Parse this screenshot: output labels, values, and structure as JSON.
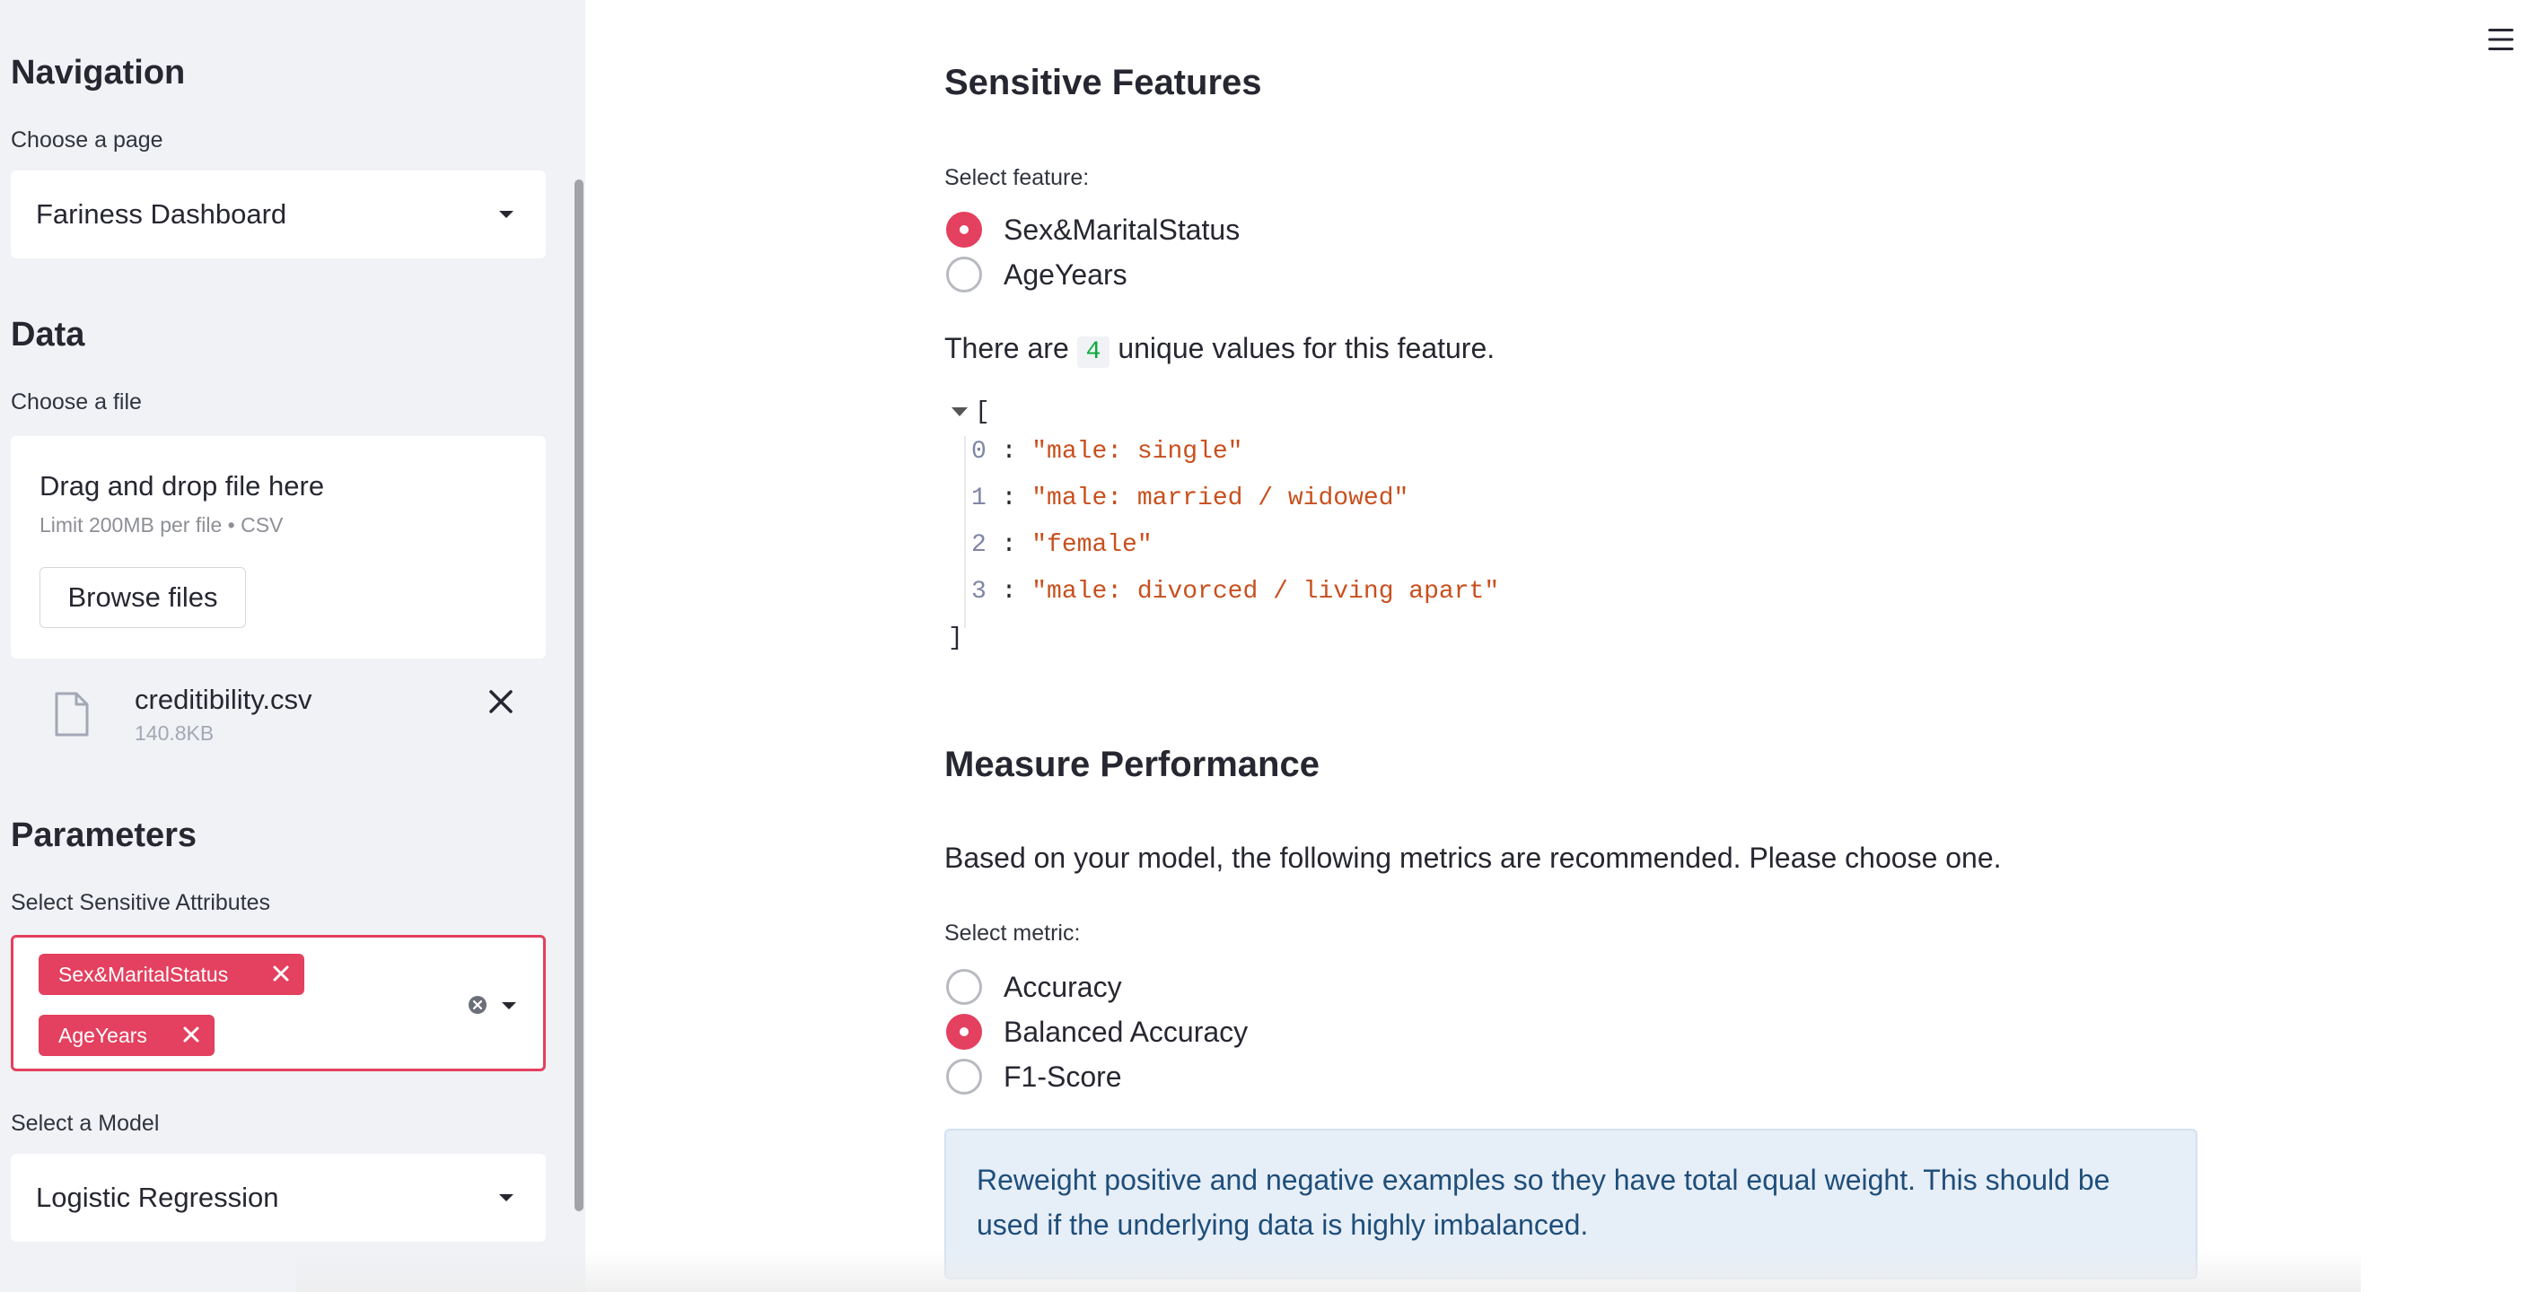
{
  "sidebar": {
    "navigation": {
      "heading": "Navigation",
      "label": "Choose a page",
      "selected": "Fariness Dashboard"
    },
    "data": {
      "heading": "Data",
      "label": "Choose a file",
      "dropzone_title": "Drag and drop file here",
      "dropzone_limit": "Limit 200MB per file • CSV",
      "browse_label": "Browse files",
      "file": {
        "name": "creditibility.csv",
        "size": "140.8KB"
      }
    },
    "parameters": {
      "heading": "Parameters",
      "sensitive_label": "Select Sensitive Attributes",
      "sensitive_selected": [
        "Sex&MaritalStatus",
        "AgeYears"
      ],
      "model_label": "Select a Model",
      "model_selected": "Logistic Regression"
    }
  },
  "main": {
    "sensitive": {
      "heading": "Sensitive Features",
      "select_label": "Select feature:",
      "options": [
        {
          "label": "Sex&MaritalStatus",
          "selected": true
        },
        {
          "label": "AgeYears",
          "selected": false
        }
      ],
      "unique_prefix": "There are",
      "unique_count": "4",
      "unique_suffix": "unique values for this feature.",
      "json_open": "[",
      "json_close": "]",
      "values": [
        {
          "index": "0",
          "value": "\"male: single\""
        },
        {
          "index": "1",
          "value": "\"male: married / widowed\""
        },
        {
          "index": "2",
          "value": "\"female\""
        },
        {
          "index": "3",
          "value": "\"male: divorced / living apart\""
        }
      ]
    },
    "performance": {
      "heading": "Measure Performance",
      "intro": "Based on your model, the following metrics are recommended. Please choose one.",
      "select_label": "Select metric:",
      "options": [
        {
          "label": "Accuracy",
          "selected": false
        },
        {
          "label": "Balanced Accuracy",
          "selected": true
        },
        {
          "label": "F1-Score",
          "selected": false
        }
      ],
      "info": "Reweight positive and negative examples so they have total equal weight. This should be used if the underlying data is highly imbalanced."
    }
  },
  "colors": {
    "accent": "#e4405f",
    "sidebar_bg": "#f0f2f6",
    "info_bg": "#e6eef8",
    "info_text": "#1f4e79",
    "code_green": "#09ab3b",
    "json_string": "#c8501e"
  },
  "icons": {
    "menu": "hamburger-menu-icon",
    "file": "file-icon",
    "remove": "close-icon",
    "dropdown": "chevron-down-icon",
    "clear": "clear-circle-icon"
  }
}
